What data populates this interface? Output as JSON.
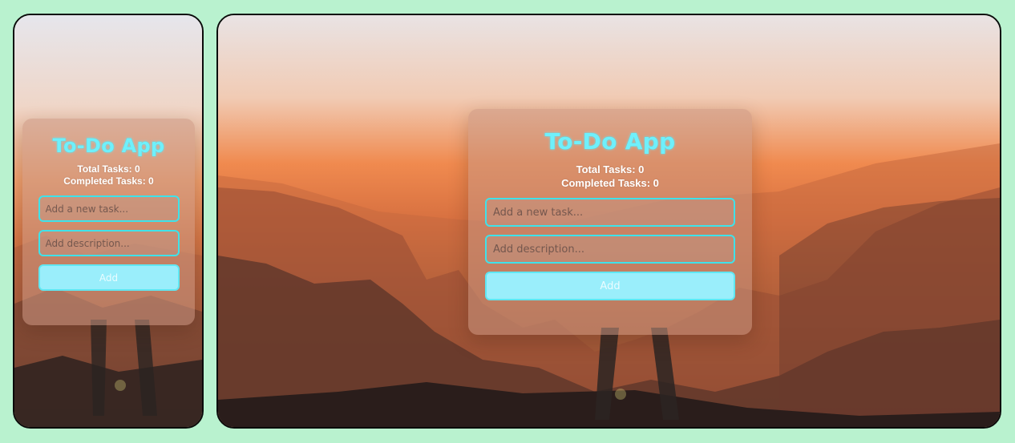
{
  "colors": {
    "page_background": "#b9f2cf",
    "accent": "#6ff0fb",
    "field_border": "#3ee2ea",
    "button_fill": "#9aeefb",
    "sky_top": "#e6e6ec",
    "sunset_orange": "#e9854f"
  },
  "mobile_view": {
    "app": {
      "title": "To-Do App",
      "total_tasks": "Total Tasks: 0",
      "completed_tasks": "Completed Tasks: 0",
      "task_placeholder": "Add a new task...",
      "description_placeholder": "Add description...",
      "add_label": "Add"
    }
  },
  "desktop_view": {
    "app": {
      "title": "To-Do App",
      "total_tasks": "Total Tasks: 0",
      "completed_tasks": "Completed Tasks: 0",
      "task_placeholder": "Add a new task...",
      "description_placeholder": "Add description...",
      "add_label": "Add"
    }
  }
}
